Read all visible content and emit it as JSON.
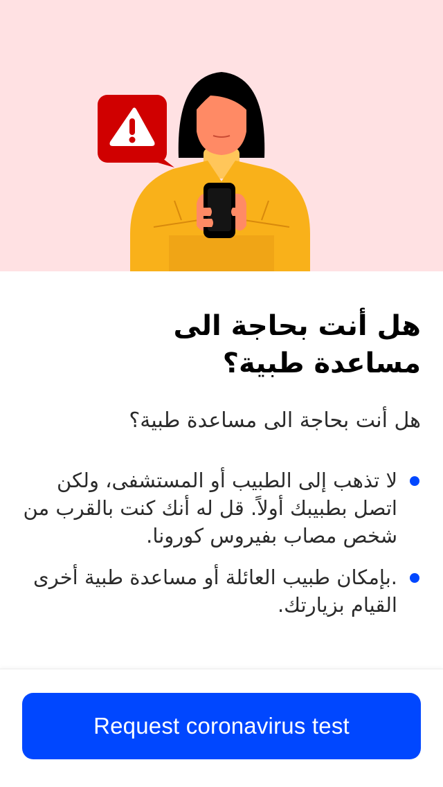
{
  "colors": {
    "hero_background": "#ffe1e3",
    "accent_blue": "#0047ff",
    "alert_red": "#d00000",
    "sweater_yellow": "#f9b11a",
    "skin": "#ff8a65",
    "hair": "#000000"
  },
  "hero": {
    "illustration": "woman-holding-phone-with-alert-bubble",
    "alert_icon": "warning-triangle-icon"
  },
  "main": {
    "title": "هل أنت بحاجة الى مساعدة طبية؟",
    "subtitle": "هل أنت بحاجة الى مساعدة طبية؟",
    "bullets": [
      "لا تذهب إلى الطبيب أو المستشفى، ولكن اتصل بطبيبك أولاً. قل له أنك كنت بالقرب من شخص مصاب بفيروس كورونا.",
      ".بإمكان طبيب العائلة أو مساعدة طبية أخرى القيام بزيارتك."
    ]
  },
  "footer": {
    "button_label": "Request coronavirus test"
  }
}
